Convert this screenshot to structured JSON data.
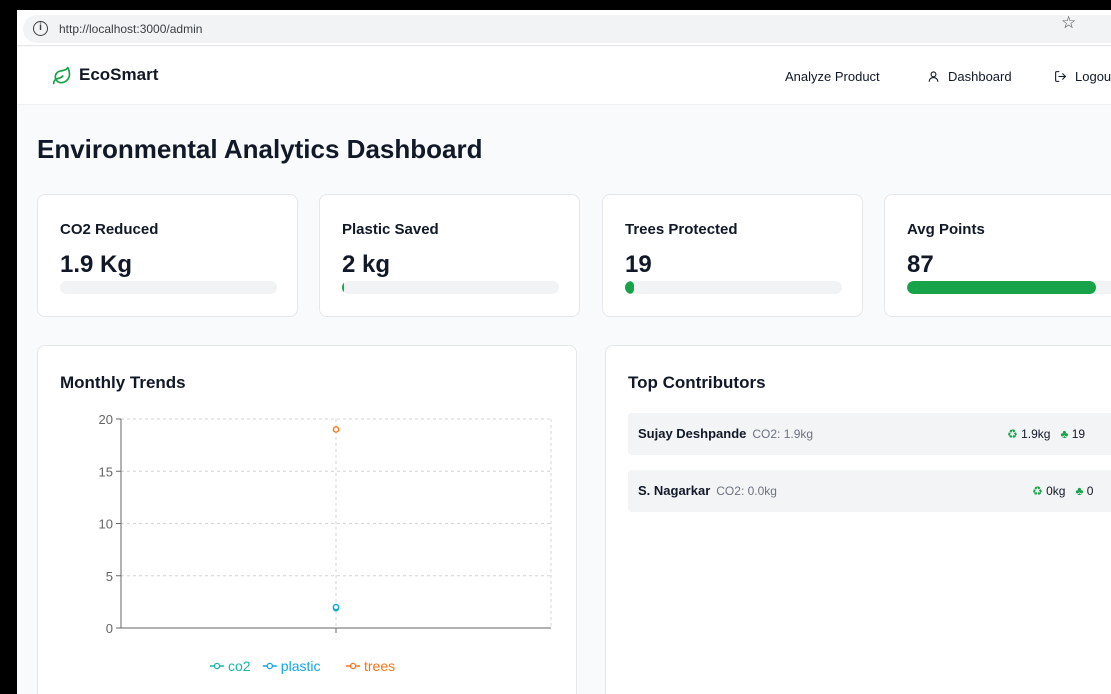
{
  "browser": {
    "url": "http://localhost:3000/admin",
    "icons": {
      "info": "info-icon",
      "bookmark": "star-icon",
      "menu": "more-icon"
    }
  },
  "nav": {
    "brand": "EcoSmart",
    "brand_icon": "leaf-icon",
    "links": [
      {
        "label": "Analyze Product"
      },
      {
        "label": "Dashboard",
        "icon": "user-icon"
      },
      {
        "label": "Logout",
        "icon": "logout-icon"
      }
    ]
  },
  "page": {
    "title": "Environmental Analytics Dashboard"
  },
  "stats": [
    {
      "label": "CO2 Reduced",
      "value": "1.9 Kg",
      "progress": 0
    },
    {
      "label": "Plastic Saved",
      "value": "2 kg",
      "progress": 0.01
    },
    {
      "label": "Trees Protected",
      "value": "19",
      "progress": 0.04
    },
    {
      "label": "Avg Points",
      "value": "87",
      "progress": 0.87
    }
  ],
  "trends": {
    "title": "Monthly Trends",
    "chart_data": {
      "type": "line",
      "categories": [
        ""
      ],
      "series": [
        {
          "name": "co2",
          "values": [
            1.9
          ],
          "color": "#14b8a6"
        },
        {
          "name": "plastic",
          "values": [
            2
          ],
          "color": "#0ea5e9"
        },
        {
          "name": "trees",
          "values": [
            19
          ],
          "color": "#f97316"
        }
      ],
      "ylim": [
        0,
        20
      ],
      "yticks": [
        "0",
        "5",
        "10",
        "15",
        "20"
      ],
      "grid": true,
      "legend": "bottom"
    }
  },
  "contributors": {
    "title": "Top Contributors",
    "rows": [
      {
        "name": "Sujay Deshpande",
        "co2": "CO2: 1.9kg",
        "recycled": "1.9kg",
        "trees": "19"
      },
      {
        "name": "S. Nagarkar",
        "co2": "CO2: 0.0kg",
        "recycled": "0kg",
        "trees": "0"
      }
    ]
  },
  "colors": {
    "accent": "#16a34a"
  }
}
